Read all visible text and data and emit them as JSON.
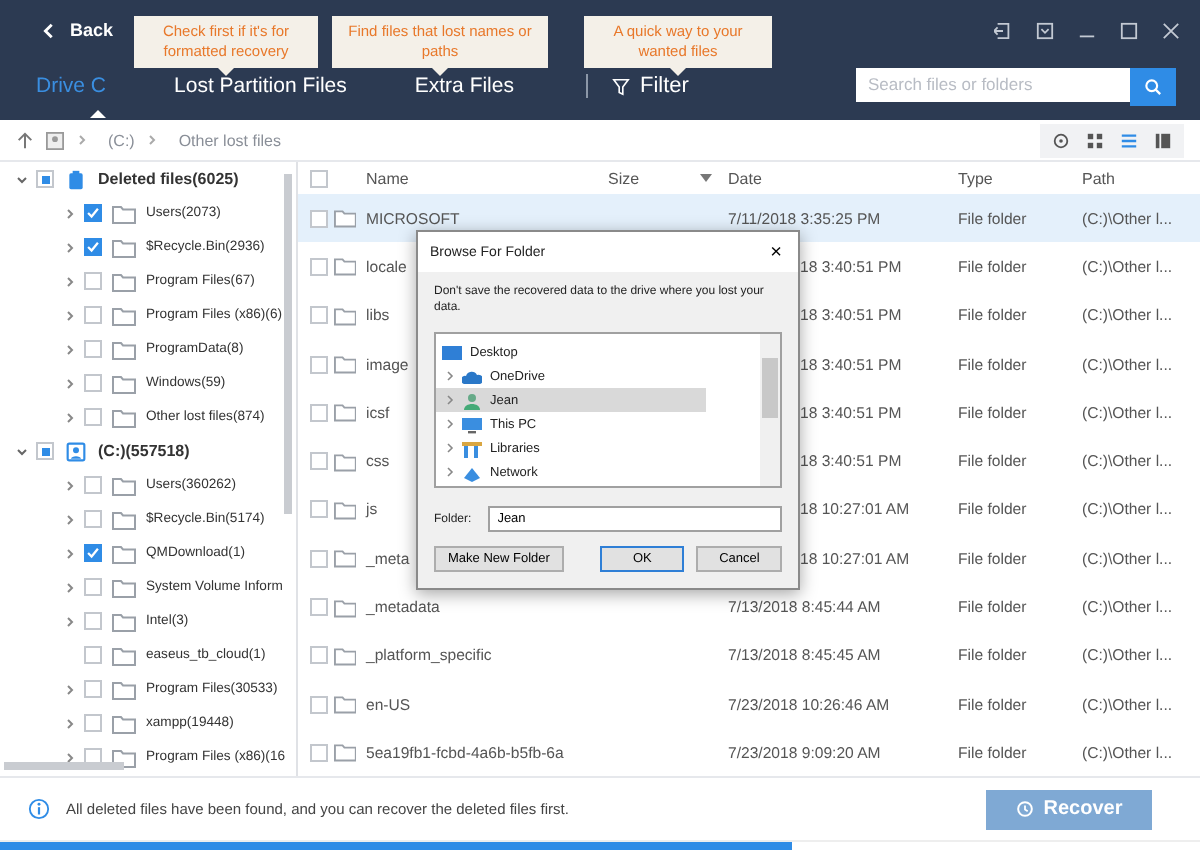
{
  "header": {
    "back": "Back",
    "tooltips": [
      "Check first if it's for formatted recovery",
      "Find files that lost names or paths",
      "A quick way to your wanted files"
    ],
    "tabs": [
      {
        "label": "Drive C",
        "selected": true
      },
      {
        "label": "Lost Partition Files",
        "selected": false
      },
      {
        "label": "Extra Files",
        "selected": false
      }
    ],
    "filter": "Filter",
    "search": {
      "placeholder": "Search files or folders"
    }
  },
  "breadcrumb": [
    "(C:)",
    "Other lost files"
  ],
  "view_modes": [
    {
      "kind": "target",
      "selected": false
    },
    {
      "kind": "grid",
      "selected": false
    },
    {
      "kind": "list",
      "selected": true
    },
    {
      "kind": "columns",
      "selected": false
    }
  ],
  "tree": [
    {
      "label": "Deleted files(6025)",
      "kind": "deleted",
      "indeterminate": true,
      "expanded": true,
      "children": [
        {
          "label": "Users(2073)",
          "checked": true,
          "expandable": true
        },
        {
          "label": "$Recycle.Bin(2936)",
          "checked": true,
          "expandable": true
        },
        {
          "label": "Program Files(67)",
          "checked": false,
          "expandable": true
        },
        {
          "label": "Program Files (x86)(6)",
          "checked": false,
          "expandable": true
        },
        {
          "label": "ProgramData(8)",
          "checked": false,
          "expandable": true
        },
        {
          "label": "Windows(59)",
          "checked": false,
          "expandable": true
        },
        {
          "label": "Other lost files(874)",
          "checked": false,
          "expandable": true
        }
      ]
    },
    {
      "label": "(C:)(557518)",
      "kind": "drive",
      "indeterminate": true,
      "expanded": true,
      "children": [
        {
          "label": "Users(360262)",
          "checked": false,
          "expandable": true
        },
        {
          "label": "$Recycle.Bin(5174)",
          "checked": false,
          "expandable": true
        },
        {
          "label": "QMDownload(1)",
          "checked": true,
          "expandable": true
        },
        {
          "label": "System Volume Inform",
          "checked": false,
          "expandable": true
        },
        {
          "label": "Intel(3)",
          "checked": false,
          "expandable": true
        },
        {
          "label": "easeus_tb_cloud(1)",
          "checked": false,
          "expandable": false
        },
        {
          "label": "Program Files(30533)",
          "checked": false,
          "expandable": true
        },
        {
          "label": "xampp(19448)",
          "checked": false,
          "expandable": true
        },
        {
          "label": "Program Files (x86)(16",
          "checked": false,
          "expandable": true
        }
      ]
    }
  ],
  "table": {
    "all_checked": false,
    "columns": [
      "Name",
      "Size",
      "Date",
      "Type",
      "Path"
    ],
    "rows": [
      {
        "name": "MICROSOFT",
        "date": "7/11/2018 3:35:25 PM",
        "type": "File folder",
        "path": "(C:)\\Other l...",
        "selected": true,
        "checked": false,
        "covered": false
      },
      {
        "name": "locale",
        "date": "18 3:40:51 PM",
        "type": "File folder",
        "path": "(C:)\\Other l...",
        "selected": false,
        "checked": false,
        "covered": true
      },
      {
        "name": "libs",
        "date": "18 3:40:51 PM",
        "type": "File folder",
        "path": "(C:)\\Other l...",
        "selected": false,
        "checked": false,
        "covered": true
      },
      {
        "name": "image",
        "date": "18 3:40:51 PM",
        "type": "File folder",
        "path": "(C:)\\Other l...",
        "selected": false,
        "checked": false,
        "covered": true
      },
      {
        "name": "icsf",
        "date": "18 3:40:51 PM",
        "type": "File folder",
        "path": "(C:)\\Other l...",
        "selected": false,
        "checked": false,
        "covered": true
      },
      {
        "name": "css",
        "date": "18 3:40:51 PM",
        "type": "File folder",
        "path": "(C:)\\Other l...",
        "selected": false,
        "checked": false,
        "covered": true
      },
      {
        "name": "js",
        "date": "18 10:27:01 AM",
        "type": "File folder",
        "path": "(C:)\\Other l...",
        "selected": false,
        "checked": false,
        "covered": true
      },
      {
        "name": "_meta",
        "date": "18 10:27:01 AM",
        "type": "File folder",
        "path": "(C:)\\Other l...",
        "selected": false,
        "checked": false,
        "covered": true
      },
      {
        "name": "_metadata",
        "date": "7/13/2018 8:45:44 AM",
        "type": "File folder",
        "path": "(C:)\\Other l...",
        "selected": false,
        "checked": false,
        "covered": false
      },
      {
        "name": "_platform_specific",
        "date": "7/13/2018 8:45:45 AM",
        "type": "File folder",
        "path": "(C:)\\Other l...",
        "selected": false,
        "checked": false,
        "covered": false
      },
      {
        "name": "en-US",
        "date": "7/23/2018 10:26:46 AM",
        "type": "File folder",
        "path": "(C:)\\Other l...",
        "selected": false,
        "checked": false,
        "covered": false
      },
      {
        "name": "5ea19fb1-fcbd-4a6b-b5fb-6a",
        "date": "7/23/2018 9:09:20 AM",
        "type": "File folder",
        "path": "(C:)\\Other l...",
        "selected": false,
        "checked": false,
        "covered": false
      }
    ]
  },
  "dialog": {
    "title": "Browse For Folder",
    "close": "×",
    "message": "Don't save the recovered data to the drive where you lost your data.",
    "tree": [
      {
        "label": "Desktop",
        "kind": "desktop",
        "selected": false,
        "children": [
          {
            "label": "OneDrive",
            "kind": "cloud",
            "selected": false
          },
          {
            "label": "Jean",
            "kind": "user",
            "selected": true
          },
          {
            "label": "This PC",
            "kind": "pc",
            "selected": false
          },
          {
            "label": "Libraries",
            "kind": "library",
            "selected": false
          },
          {
            "label": "Network",
            "kind": "network",
            "selected": false
          }
        ]
      }
    ],
    "folder_label": "Folder:",
    "folder_value": "Jean",
    "buttons": [
      {
        "label": "Make New Folder",
        "default": false
      },
      {
        "label": "OK",
        "default": true
      },
      {
        "label": "Cancel",
        "default": false
      }
    ]
  },
  "status_bar": {
    "message": "All deleted files have been found, and you can recover the deleted files first.",
    "recover": {
      "label": "Recover",
      "disabled": true
    },
    "progress": {
      "level": 0.66
    }
  }
}
